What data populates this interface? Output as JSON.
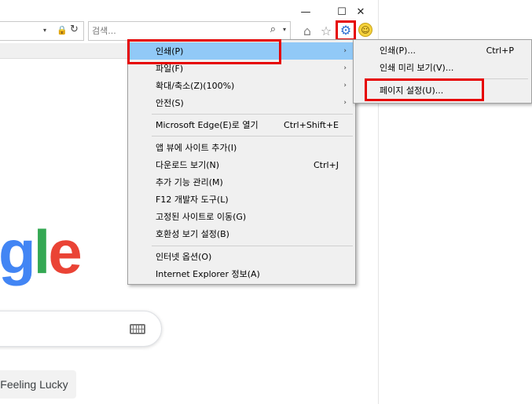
{
  "window": {
    "minimize": "—",
    "maximize": "☐",
    "close": "✕"
  },
  "address_bar": {
    "dropdown": "▾",
    "lock": "🔒",
    "refresh": "↻"
  },
  "search_bar": {
    "placeholder": "검색...",
    "search_icon": "⌕",
    "dropdown": "▾"
  },
  "toolbar": {
    "home_icon": "⌂",
    "favorites_icon": "☆",
    "tools_icon": "⚙",
    "smiley_icon": "☺"
  },
  "google": {
    "logo_parts": [
      "g",
      "l",
      "e"
    ],
    "colors": {
      "g": "#4285f4",
      "l": "#34a853",
      "e": "#ea4335"
    },
    "lucky_button": "Feeling Lucky"
  },
  "main_menu": {
    "items": [
      {
        "label": "인쇄(P)",
        "arrow": "›",
        "highlighted": true
      },
      {
        "label": "파일(F)",
        "arrow": "›"
      },
      {
        "label": "확대/축소(Z)(100%)",
        "arrow": "›"
      },
      {
        "label": "안전(S)",
        "arrow": "›"
      },
      {
        "label": "Microsoft Edge(E)로 열기",
        "shortcut": "Ctrl+Shift+E"
      },
      {
        "label": "앱 뷰에 사이트 추가(I)"
      },
      {
        "label": "다운로드 보기(N)",
        "shortcut": "Ctrl+J"
      },
      {
        "label": "추가 기능 관리(M)"
      },
      {
        "label": "F12 개발자 도구(L)"
      },
      {
        "label": "고정된 사이트로 이동(G)"
      },
      {
        "label": "호환성 보기 설정(B)"
      },
      {
        "label": "인터넷 옵션(O)"
      },
      {
        "label": "Internet Explorer 정보(A)"
      }
    ]
  },
  "print_submenu": {
    "items": [
      {
        "label": "인쇄(P)...",
        "shortcut": "Ctrl+P"
      },
      {
        "label": "인쇄 미리 보기(V)..."
      },
      {
        "label": "페이지 설정(U)..."
      }
    ]
  },
  "accent_colors": {
    "highlight_border": "#e60000",
    "menu_hover": "#91c9f7",
    "menu_bg": "#f0f0f0"
  }
}
